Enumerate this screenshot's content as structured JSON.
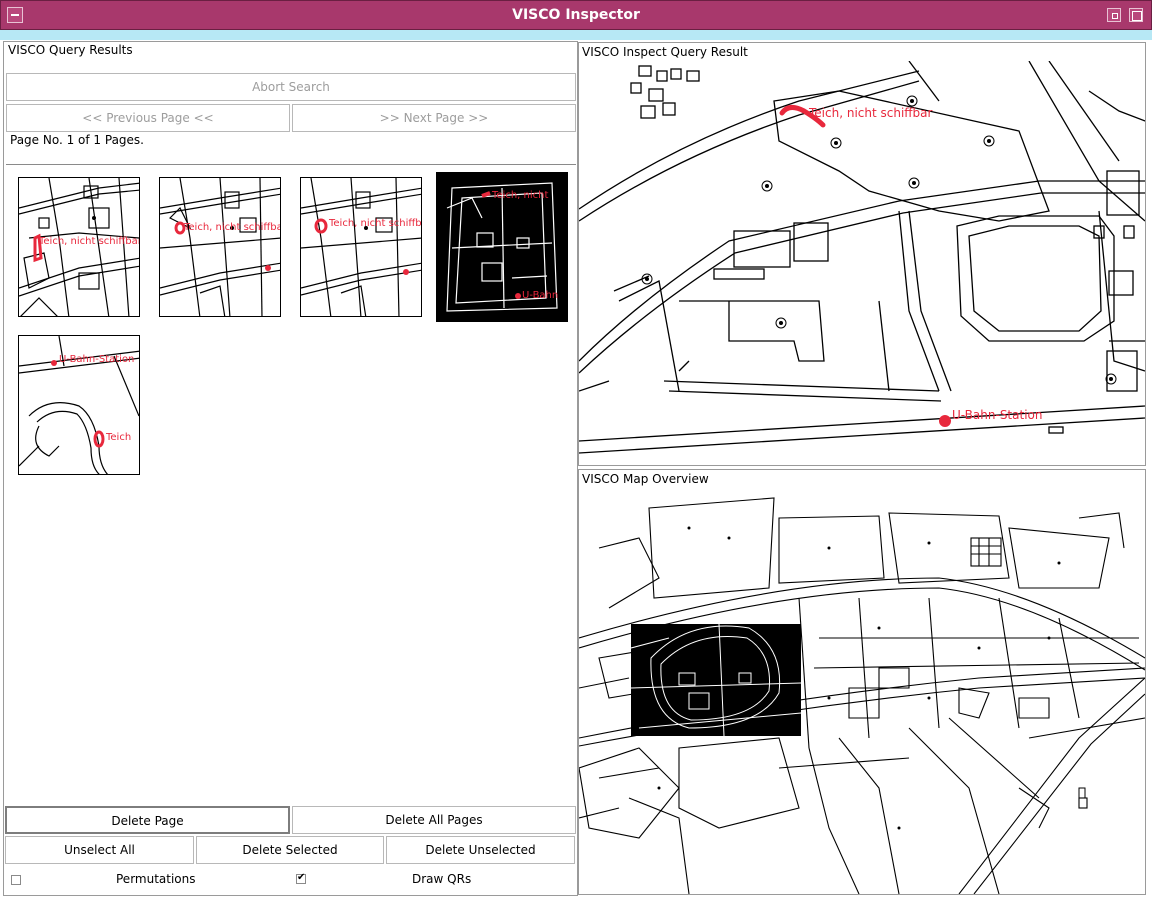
{
  "window": {
    "title": "VISCO Inspector"
  },
  "left_panel": {
    "title": "VISCO Query Results",
    "abort_label": "Abort Search",
    "prev_label": "<< Previous Page <<",
    "next_label": ">> Next Page >>",
    "page_info": "Page No. 1 of 1 Pages.",
    "results": [
      {
        "label": "Teich, nicht schiffbar",
        "selected": false
      },
      {
        "label": "Teich, nicht schiffbar",
        "selected": false
      },
      {
        "label": "Teich, nicht schiffbar",
        "selected": false
      },
      {
        "label": "Teich, nicht",
        "label2": "U-Bahn",
        "selected": true
      },
      {
        "label": "U-Bahn-Station",
        "label2": "Teich",
        "selected": false
      }
    ],
    "delete_page": "Delete Page",
    "delete_all": "Delete All Pages",
    "unselect_all": "Unselect All",
    "delete_selected": "Delete Selected",
    "delete_unselected": "Delete Unselected",
    "permutations": {
      "label": "Permutations",
      "checked": false
    },
    "draw_qrs": {
      "label": "Draw QRs",
      "checked": true
    }
  },
  "inspect_panel": {
    "title": "VISCO Inspect Query Result",
    "label_pond": "Teich, nicht schiffbar",
    "label_station": "U-Bahn-Station"
  },
  "overview_panel": {
    "title": "VISCO Map Overview"
  },
  "colors": {
    "titlebar": "#a8386c",
    "stripe": "#b7e8f5",
    "highlight": "#e8283c"
  }
}
